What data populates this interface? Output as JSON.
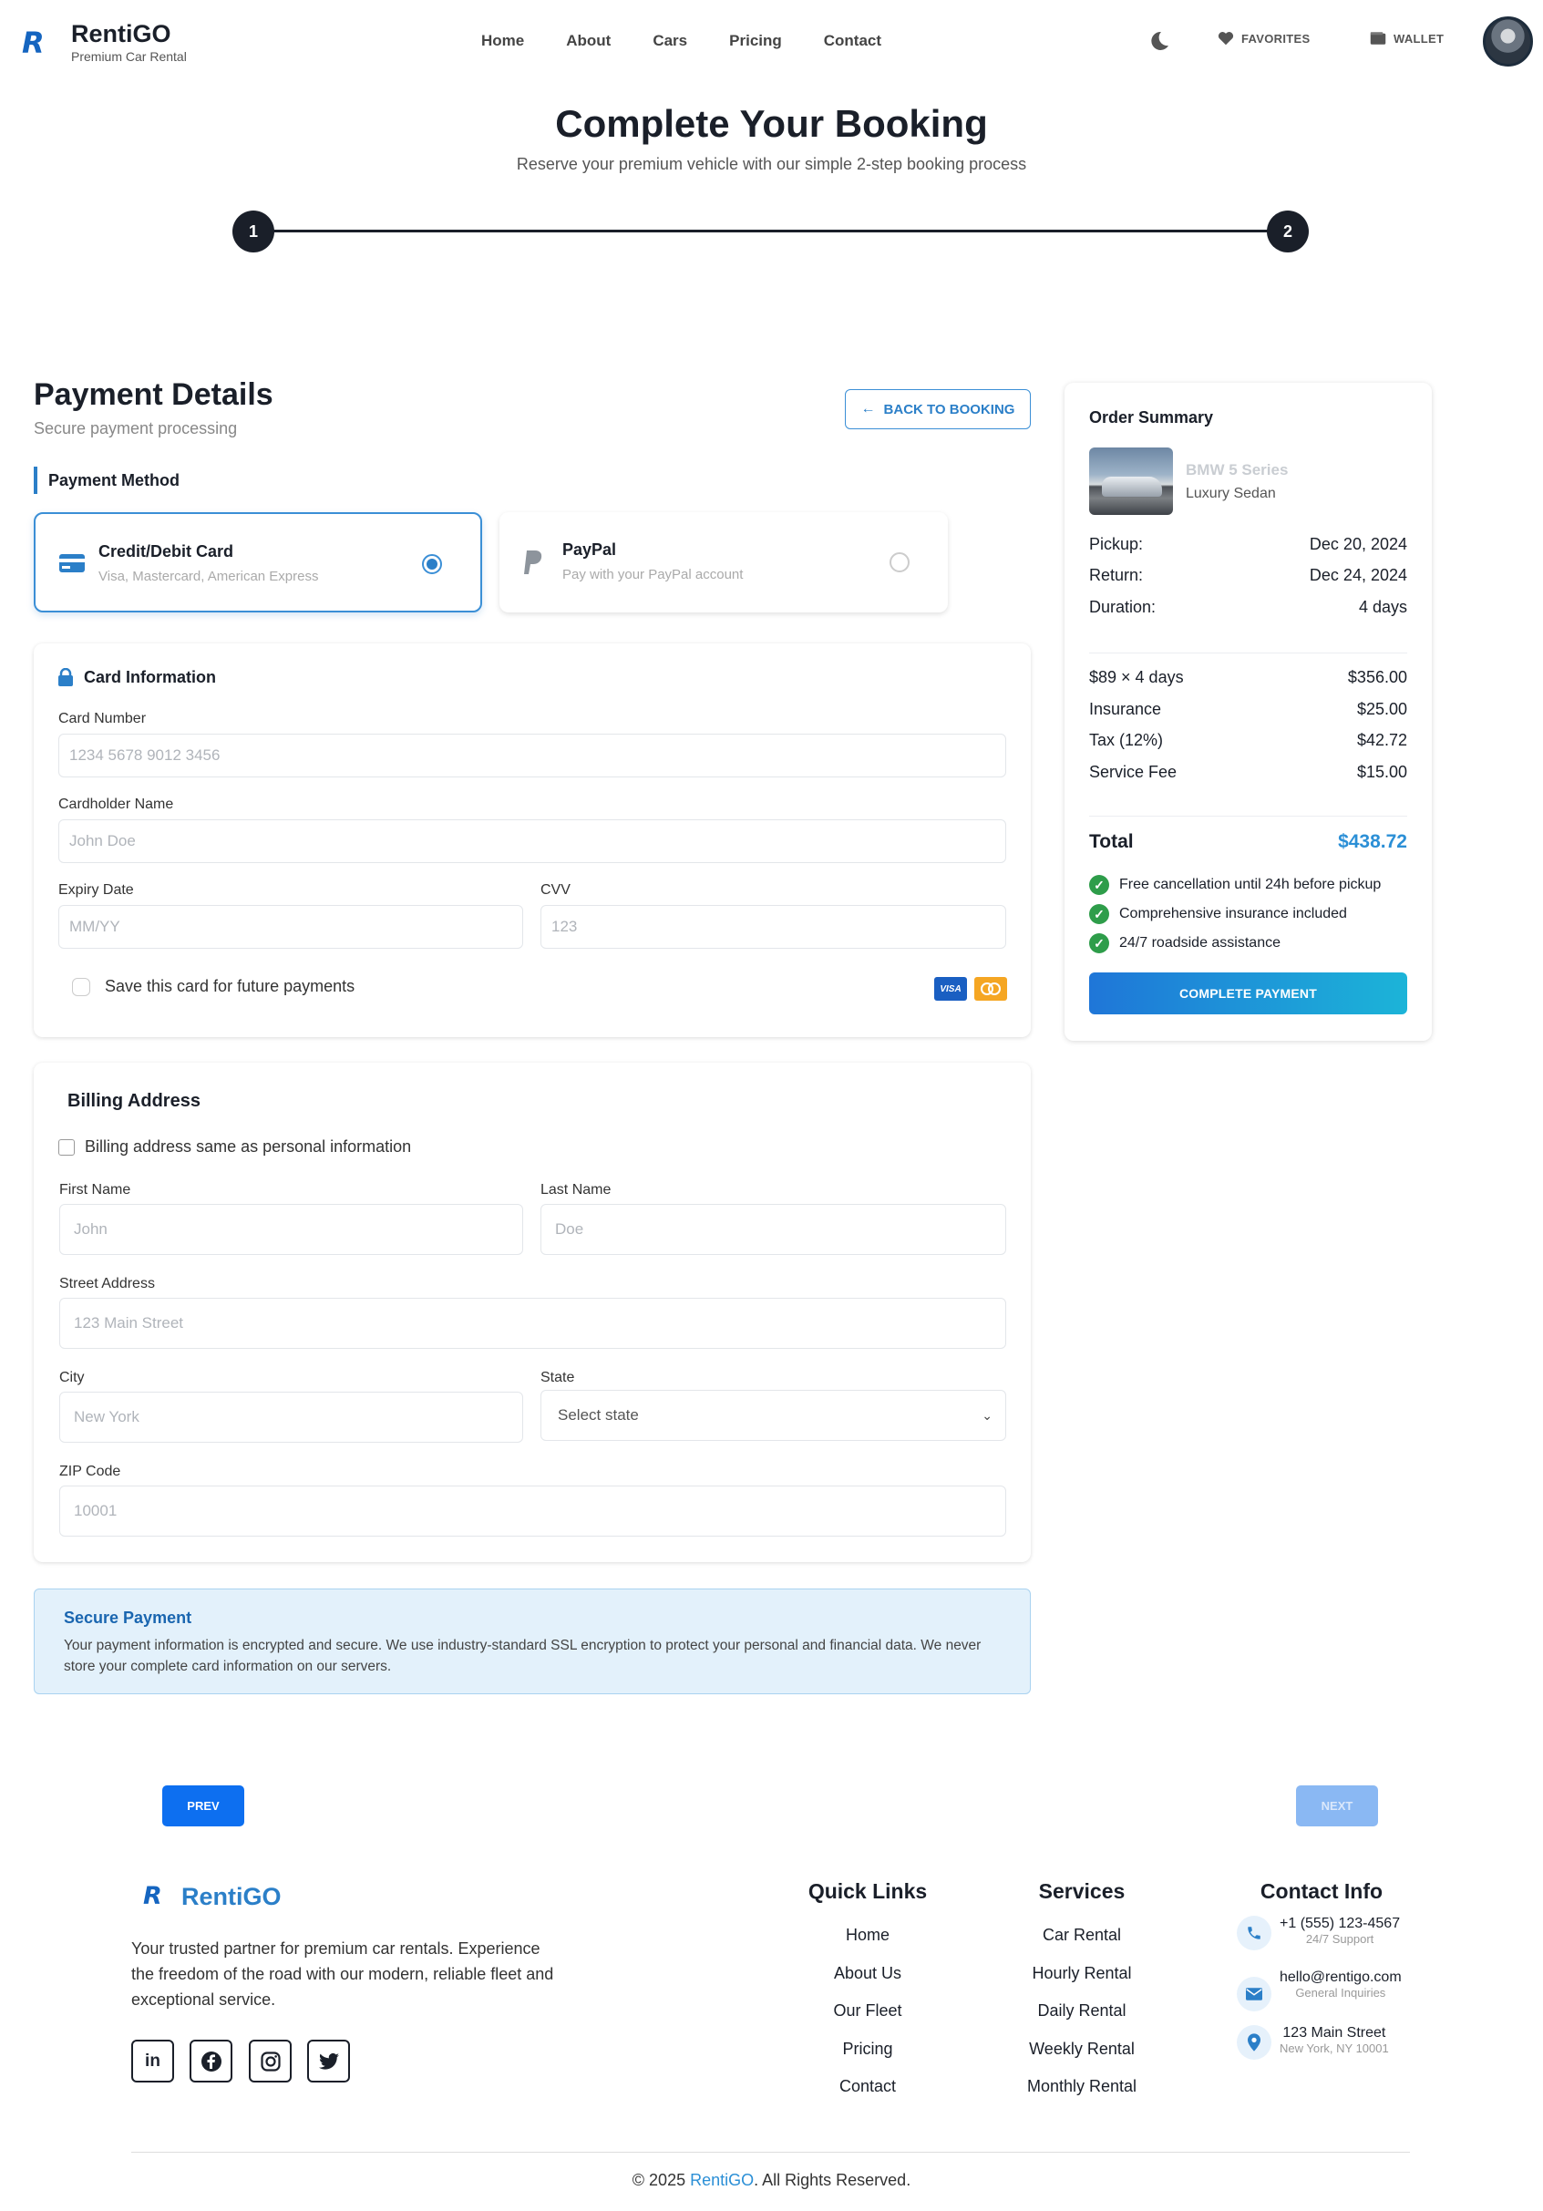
{
  "header": {
    "brand": "RentiGO",
    "brand_sub": "Premium Car Rental",
    "nav": [
      "Home",
      "About",
      "Cars",
      "Pricing",
      "Contact"
    ],
    "favorites": "FAVORITES",
    "wallet": "WALLET"
  },
  "page": {
    "title": "Complete Your Booking",
    "subtitle": "Reserve your premium vehicle with our simple 2-step booking process",
    "steps": [
      "1",
      "2"
    ]
  },
  "payment": {
    "title": "Payment Details",
    "subtitle": "Secure payment processing",
    "back_label": "BACK TO BOOKING",
    "method_label": "Payment Method",
    "methods": [
      {
        "title": "Credit/Debit Card",
        "desc": "Visa, Mastercard, American Express",
        "selected": true
      },
      {
        "title": "PayPal",
        "desc": "Pay with your PayPal account",
        "selected": false
      }
    ]
  },
  "card": {
    "title": "Card Information",
    "number_label": "Card Number",
    "number_placeholder": "1234 5678 9012 3456",
    "name_label": "Cardholder Name",
    "name_placeholder": "John Doe",
    "expiry_label": "Expiry Date",
    "expiry_placeholder": "MM/YY",
    "cvv_label": "CVV",
    "cvv_placeholder": "123",
    "save_label": "Save this card for future payments",
    "visa": "VISA"
  },
  "billing": {
    "title": "Billing Address",
    "same_label": "Billing address same as personal information",
    "first_label": "First Name",
    "first_placeholder": "John",
    "last_label": "Last Name",
    "last_placeholder": "Doe",
    "street_label": "Street Address",
    "street_placeholder": "123 Main Street",
    "city_label": "City",
    "city_placeholder": "New York",
    "state_label": "State",
    "state_value": "Select state",
    "zip_label": "ZIP Code",
    "zip_placeholder": "10001"
  },
  "secure": {
    "title": "Secure Payment",
    "text": "Your payment information is encrypted and secure. We use industry-standard SSL encryption to protect your personal and financial data. We never store your complete card information on our servers."
  },
  "summary": {
    "title": "Order Summary",
    "car_name": "BMW 5 Series",
    "car_type": "Luxury Sedan",
    "dates": [
      {
        "label": "Pickup:",
        "value": "Dec 20, 2024"
      },
      {
        "label": "Return:",
        "value": "Dec 24, 2024"
      },
      {
        "label": "Duration:",
        "value": "4 days"
      }
    ],
    "costs": [
      {
        "label": "$89 × 4 days",
        "value": "$356.00"
      },
      {
        "label": "Insurance",
        "value": "$25.00"
      },
      {
        "label": "Tax (12%)",
        "value": "$42.72"
      },
      {
        "label": "Service Fee",
        "value": "$15.00"
      }
    ],
    "total_label": "Total",
    "total_value": "$438.72",
    "features": [
      "Free cancellation until 24h before pickup",
      "Comprehensive insurance included",
      "24/7 roadside assistance"
    ],
    "pay_label": "COMPLETE PAYMENT"
  },
  "pager": {
    "prev": "PREV",
    "next": "NEXT"
  },
  "footer": {
    "brand": "RentiGO",
    "desc": "Your trusted partner for premium car rentals. Experience the freedom of the road with our modern, reliable fleet and exceptional service.",
    "quick_title": "Quick Links",
    "quick": [
      "Home",
      "About Us",
      "Our Fleet",
      "Pricing",
      "Contact"
    ],
    "services_title": "Services",
    "services": [
      "Car Rental",
      "Hourly Rental",
      "Daily Rental",
      "Weekly Rental",
      "Monthly Rental"
    ],
    "contact_title": "Contact Info",
    "phone": "+1 (555) 123-4567",
    "phone_sub": "24/7 Support",
    "email": "hello@rentigo.com",
    "email_sub": "General Inquiries",
    "address": "123 Main Street",
    "address_sub": "New York, NY 10001",
    "copy_pre": "© 2025 ",
    "copy_brand": "RentiGO",
    "copy_post": ". All Rights Reserved."
  }
}
